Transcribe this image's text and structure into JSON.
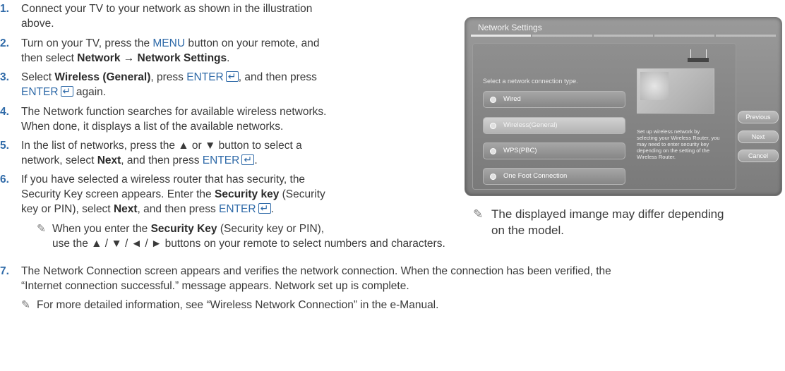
{
  "steps": [
    {
      "num": "1.",
      "line1": "Connect your TV to your network as shown in the illustration",
      "line2": "above."
    },
    {
      "num": "2.",
      "l1a": "Turn on your TV, press the ",
      "l1b": "MENU",
      "l1c": " button on your remote, and",
      "l2a": "then select ",
      "l2b": "Network → Network Settings",
      "l2c": "."
    },
    {
      "num": "3.",
      "l1a": "Select ",
      "l1b": "Wireless (General)",
      "l1c": ", press ",
      "l1d": "ENTER",
      "l1e": ", and then press",
      "l2a": "ENTER",
      "l2b": " again."
    },
    {
      "num": "4.",
      "line1": "The Network function searches for available wireless networks.",
      "line2": "When done, it displays a list of the available networks."
    },
    {
      "num": "5.",
      "line1": "In the list of networks, press the ▲ or ▼ button to select a",
      "l2a": "network, select ",
      "l2b": "Next",
      "l2c": ", and then press ",
      "l2d": "ENTER",
      "l2e": "."
    },
    {
      "num": "6.",
      "line1": "If you have selected a wireless router that has security, the",
      "l2a": "Security Key screen appears. Enter the ",
      "l2b": "Security key",
      "l2c": " (Security",
      "l3a": "key or PIN), select ",
      "l3b": "Next",
      "l3c": ", and then press ",
      "l3d": "ENTER",
      "l3e": "."
    },
    {
      "num": "7.",
      "line1": "The Network Connection screen appears and verifies the network connection. When the connection has been verified, the",
      "line2": "“Internet connection successful.” message appears. Network set up is complete."
    }
  ],
  "note6": {
    "a": "When you enter the ",
    "b": "Security Key",
    "c": " (Security key or PIN),",
    "line2": "use the ▲ / ▼ / ◄ / ► buttons on your remote to select numbers and characters."
  },
  "note7": "For more detailed information, see “Wireless Network Connection” in the e-Manual.",
  "figure_note": {
    "line1": "The displayed imange may differ depending",
    "line2": "on the model."
  },
  "tv": {
    "title": "Network Settings",
    "prompt": "Select a network connection type.",
    "options": [
      {
        "label": "Wired",
        "selected": false
      },
      {
        "label": "Wireless(General)",
        "selected": true
      },
      {
        "label": "WPS(PBC)",
        "selected": false
      },
      {
        "label": "One Foot Connection",
        "selected": false
      }
    ],
    "description": "Set up wireless network by selecting your Wireless Router, you may need to enter security key depending on the setting of the Wireless Router.",
    "buttons": {
      "previous": "Previous",
      "next": "Next",
      "cancel": "Cancel"
    }
  },
  "icons": {
    "note": "pencil-note-icon",
    "enter": "enter-key-icon"
  },
  "colors": {
    "step_number": "#2f6aa8",
    "text": "#3a3a3a"
  }
}
